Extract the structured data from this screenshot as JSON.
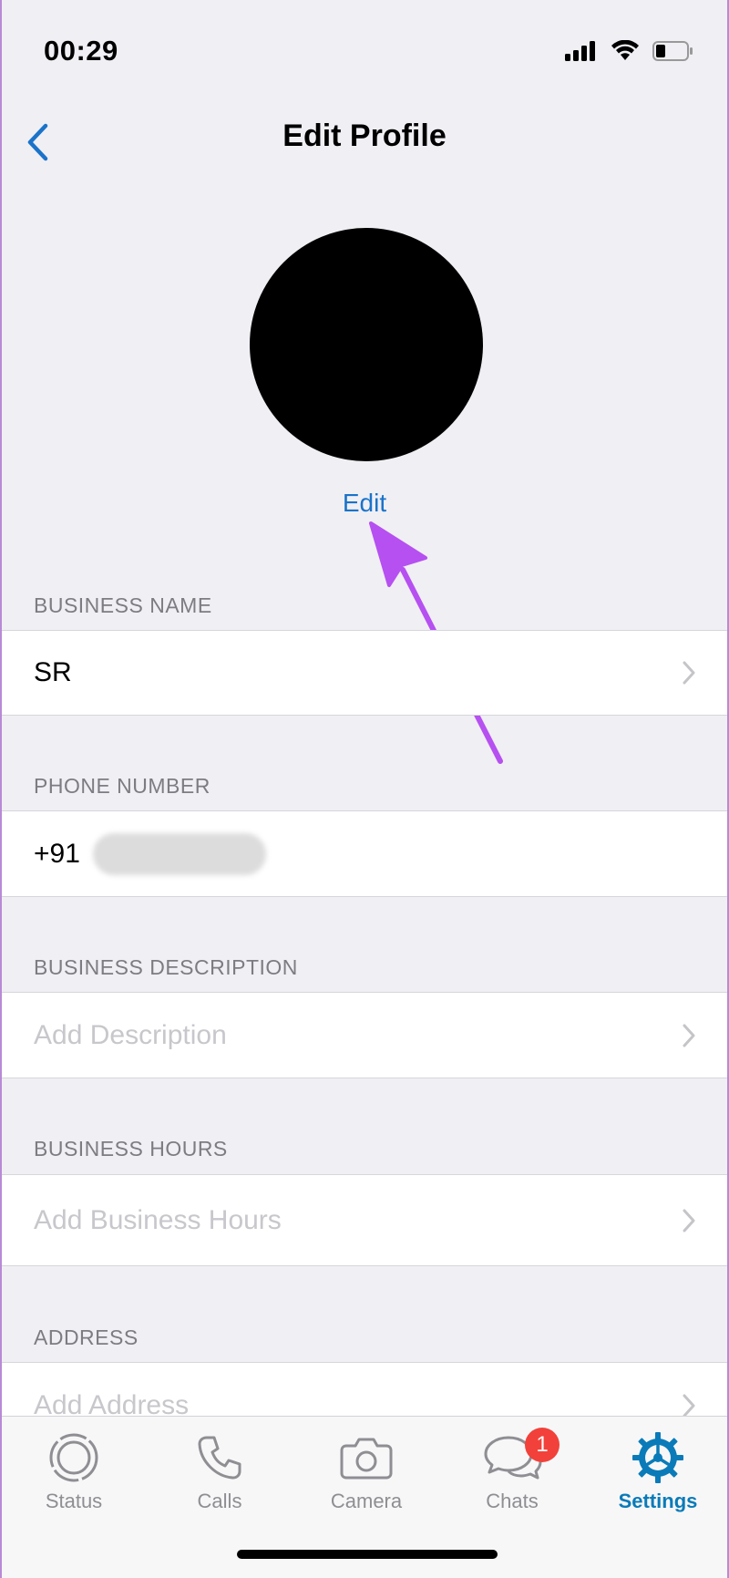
{
  "status_bar": {
    "time": "00:29",
    "icons": [
      "signal-icon",
      "wifi-icon",
      "battery-icon"
    ]
  },
  "nav": {
    "title": "Edit Profile",
    "back_icon": "chevron-left-icon"
  },
  "profile": {
    "edit_label": "Edit"
  },
  "sections": {
    "business_name": {
      "header": "BUSINESS NAME",
      "value": "SR"
    },
    "phone_number": {
      "header": "PHONE NUMBER",
      "value": "+91"
    },
    "business_description": {
      "header": "BUSINESS DESCRIPTION",
      "placeholder": "Add Description"
    },
    "business_hours": {
      "header": "BUSINESS HOURS",
      "placeholder": "Add Business Hours"
    },
    "address": {
      "header": "ADDRESS",
      "placeholder": "Add Address"
    }
  },
  "tab_bar": {
    "tabs": [
      {
        "label": "Status",
        "icon": "status-icon"
      },
      {
        "label": "Calls",
        "icon": "phone-icon"
      },
      {
        "label": "Camera",
        "icon": "camera-icon"
      },
      {
        "label": "Chats",
        "icon": "chat-bubbles-icon",
        "badge": "1"
      },
      {
        "label": "Settings",
        "icon": "gear-icon",
        "active": true
      }
    ]
  },
  "colors": {
    "accent": "#1a73c9",
    "active_tab": "#0a7bb8",
    "badge": "#f2413a",
    "annotation_arrow": "#b650f0",
    "background": "#f0eff4"
  }
}
